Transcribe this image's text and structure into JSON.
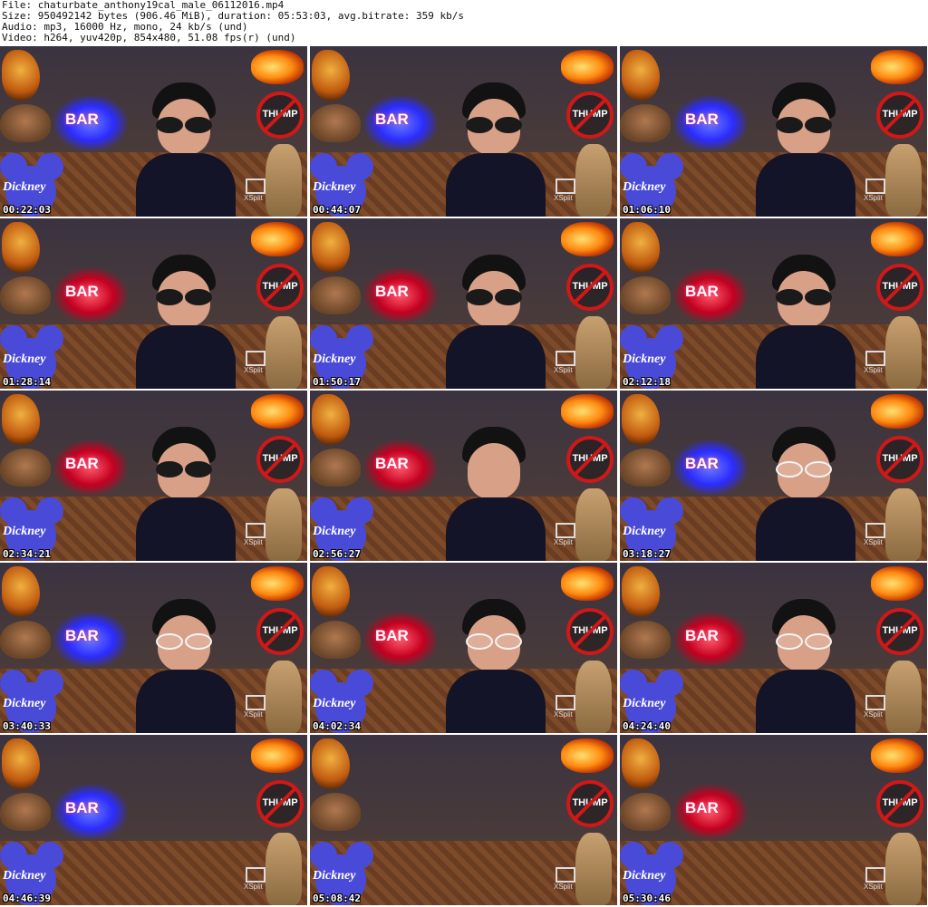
{
  "header": {
    "file_line": "File: chaturbate_anthony19cal_male_06112016.mp4",
    "size_line": "Size: 950492142 bytes (906.46 MiB), duration: 05:53:03, avg.bitrate: 359 kb/s",
    "audio_line": "Audio: mp3, 16000 Hz, mono, 24 kb/s (und)",
    "video_line": "Video: h264, yuv420p, 854x480, 51.08 fps(r) (und)"
  },
  "overlay": {
    "neon_text": "BAR",
    "nosign_text": "THUMP",
    "logo_text": "Dickney",
    "xsplit_text": "XSplit"
  },
  "thumbnails": [
    {
      "time": "00:22:03",
      "neon": "blue",
      "glasses": "dark"
    },
    {
      "time": "00:44:07",
      "neon": "blue",
      "glasses": "dark"
    },
    {
      "time": "01:06:10",
      "neon": "blue",
      "glasses": "dark"
    },
    {
      "time": "01:28:14",
      "neon": "red",
      "glasses": "dark"
    },
    {
      "time": "01:50:17",
      "neon": "red",
      "glasses": "dark"
    },
    {
      "time": "02:12:18",
      "neon": "red",
      "glasses": "dark"
    },
    {
      "time": "02:34:21",
      "neon": "red",
      "glasses": "dark"
    },
    {
      "time": "02:56:27",
      "neon": "red",
      "glasses": "none"
    },
    {
      "time": "03:18:27",
      "neon": "blue",
      "glasses": "white"
    },
    {
      "time": "03:40:33",
      "neon": "blue",
      "glasses": "white"
    },
    {
      "time": "04:02:34",
      "neon": "red",
      "glasses": "white"
    },
    {
      "time": "04:24:40",
      "neon": "red",
      "glasses": "white"
    },
    {
      "time": "04:46:39",
      "neon": "blue",
      "glasses": "none"
    },
    {
      "time": "05:08:42",
      "neon": "none",
      "glasses": "none"
    },
    {
      "time": "05:30:46",
      "neon": "red",
      "glasses": "none"
    }
  ]
}
